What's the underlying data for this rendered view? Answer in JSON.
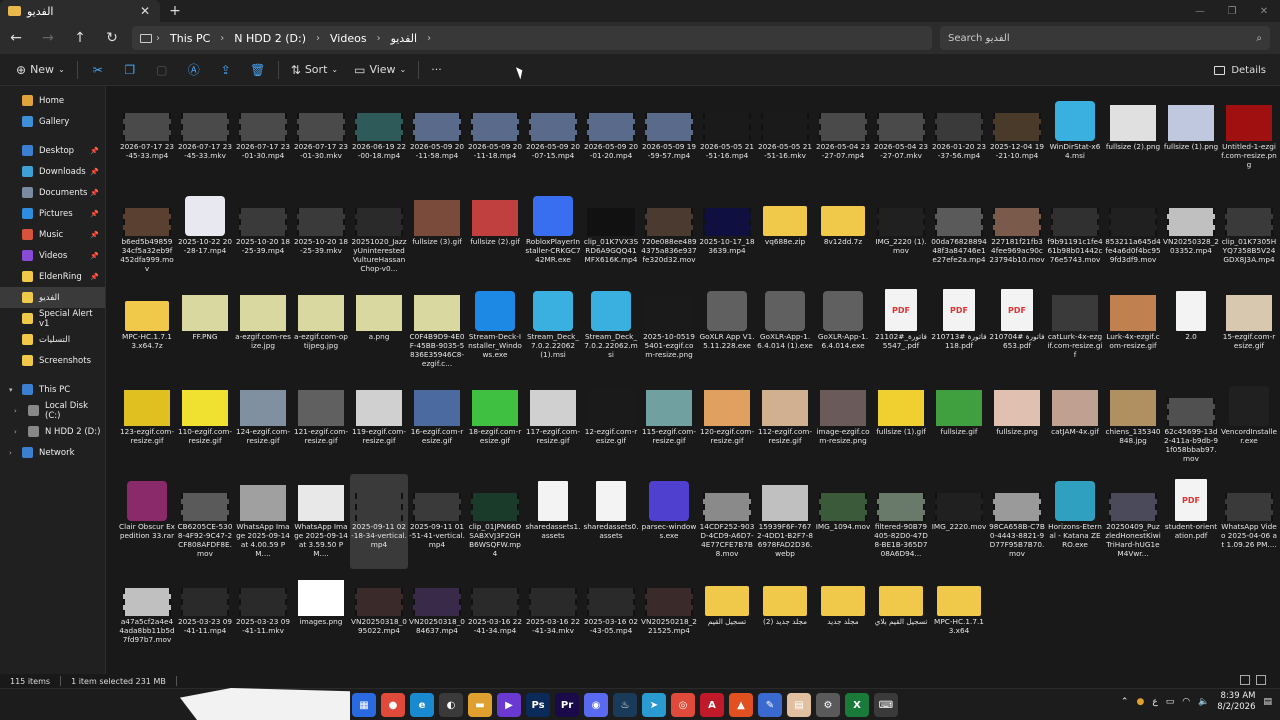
{
  "tab": {
    "title": "الفديو",
    "close": "✕",
    "new_tab": "+"
  },
  "nav": {
    "back": "←",
    "forward": "→",
    "up": "↑",
    "refresh": "↻"
  },
  "address": {
    "crumbs": [
      "This PC",
      "N HDD 2 (D:)",
      "Videos",
      "الفديو"
    ],
    "search_placeholder": "Search الفديو"
  },
  "command_bar": {
    "new_label": "New",
    "sort_label": "Sort",
    "view_label": "View",
    "more_label": "···",
    "details_label": "Details"
  },
  "sidebar": {
    "items": [
      {
        "label": "Home",
        "color": "#e0a23c"
      },
      {
        "label": "Gallery",
        "color": "#3f8fd8"
      },
      {
        "label": "Desktop",
        "color": "#3a7fd0",
        "pinned": true
      },
      {
        "label": "Downloads",
        "color": "#3fa0d8",
        "pinned": true
      },
      {
        "label": "Documents",
        "color": "#7a8aa0",
        "pinned": true
      },
      {
        "label": "Pictures",
        "color": "#2f8de0",
        "pinned": true
      },
      {
        "label": "Music",
        "color": "#d8533c",
        "pinned": true
      },
      {
        "label": "Videos",
        "color": "#8a4ad8",
        "pinned": true
      },
      {
        "label": "EldenRing",
        "color": "#f0c94a",
        "pinned": true
      },
      {
        "label": "الفديو",
        "color": "#f0c94a"
      },
      {
        "label": "Special Alert v1",
        "color": "#f0c94a"
      },
      {
        "label": "التسليات",
        "color": "#f0c94a"
      },
      {
        "label": "Screenshots",
        "color": "#f0c94a"
      },
      {
        "label": "This PC",
        "color": "#3a7fd0",
        "expand": "▾"
      },
      {
        "label": "Local Disk (C:)",
        "color": "#888888",
        "expand": "›"
      },
      {
        "label": "N HDD 2 (D:)",
        "color": "#888888",
        "expand": "›"
      },
      {
        "label": "Network",
        "color": "#3a7fd0",
        "expand": "›"
      }
    ]
  },
  "files": [
    {
      "name": "2026-07-17 23-45-33.mp4",
      "kind": "video",
      "color": "#4a4a4a"
    },
    {
      "name": "2026-07-17 23-45-33.mkv",
      "kind": "video",
      "color": "#4a4a4a"
    },
    {
      "name": "2026-07-17 23-01-30.mp4",
      "kind": "video",
      "color": "#4a4a4a"
    },
    {
      "name": "2026-07-17 23-01-30.mkv",
      "kind": "video",
      "color": "#4a4a4a"
    },
    {
      "name": "2026-06-19 22-00-18.mp4",
      "kind": "video",
      "color": "#2e5a5a"
    },
    {
      "name": "2026-05-09 20-11-58.mp4",
      "kind": "video",
      "color": "#5a6a8a"
    },
    {
      "name": "2026-05-09 20-11-18.mp4",
      "kind": "video",
      "color": "#5a6a8a"
    },
    {
      "name": "2026-05-09 20-07-15.mp4",
      "kind": "video",
      "color": "#5a6a8a"
    },
    {
      "name": "2026-05-09 20-01-20.mp4",
      "kind": "video",
      "color": "#5a6a8a"
    },
    {
      "name": "2026-05-09 19-59-57.mp4",
      "kind": "video",
      "color": "#5a6a8a"
    },
    {
      "name": "2026-05-05 21-51-16.mp4",
      "kind": "video",
      "color": "#1a1a1a"
    },
    {
      "name": "2026-05-05 21-51-16.mkv",
      "kind": "video",
      "color": "#1a1a1a"
    },
    {
      "name": "2026-05-04 23-27-07.mp4",
      "kind": "video",
      "color": "#4a4a4a"
    },
    {
      "name": "2026-05-04 23-27-07.mkv",
      "kind": "video",
      "color": "#4a4a4a"
    },
    {
      "name": "2026-01-20 23-37-56.mp4",
      "kind": "video",
      "color": "#3a3a3a"
    },
    {
      "name": "2025-12-04 19-21-10.mp4",
      "kind": "video",
      "color": "#4a3a2a"
    },
    {
      "name": "WinDirStat-x64.msi",
      "kind": "app",
      "color": "#3ab0e0"
    },
    {
      "name": "fullsize (2).png",
      "kind": "img",
      "color": "#e0e0e0"
    },
    {
      "name": "fullsize (1).png",
      "kind": "img",
      "color": "#c0c8e0"
    },
    {
      "name": "Untitled-1-ezgif.com-resize.png",
      "kind": "img",
      "color": "#a01010"
    },
    {
      "name": "b6ed5b49859 34cf5a32eb9f 452dfa999.mov",
      "kind": "video",
      "color": "#5a4030"
    },
    {
      "name": "2025-10-22 20-28-17.mp4",
      "kind": "app",
      "color": "#e8e8f0"
    },
    {
      "name": "2025-10-20 18-25-39.mp4",
      "kind": "video",
      "color": "#3a3a3a"
    },
    {
      "name": "2025-10-20 18-25-39.mkv",
      "kind": "video",
      "color": "#3a3a3a"
    },
    {
      "name": "20251020_JazzyUninterestedVultureHassanChop-v0...",
      "kind": "video",
      "color": "#2a2a2a"
    },
    {
      "name": "fullsize (3).gif",
      "kind": "img",
      "color": "#7a4a3a"
    },
    {
      "name": "fullsize (2).gif",
      "kind": "img",
      "color": "#c04040"
    },
    {
      "name": "RobloxPlayerInstaller-CRKGC742MR.exe",
      "kind": "app",
      "color": "#3a6ef0"
    },
    {
      "name": "clip_01K7VX3SRD6A9GQQ41MFX616K.mp4",
      "kind": "video",
      "color": "#111111"
    },
    {
      "name": "720e088ee4894375a836e937fe320d32.mov",
      "kind": "video",
      "color": "#4a3a30"
    },
    {
      "name": "2025-10-17_183639.mp4",
      "kind": "video",
      "color": "#101040"
    },
    {
      "name": "vq688e.zip",
      "kind": "folder",
      "color": "#f0c94a"
    },
    {
      "name": "8v12dd.7z",
      "kind": "folder",
      "color": "#f0c94a"
    },
    {
      "name": "IMG_2220 (1).mov",
      "kind": "video",
      "color": "#202020"
    },
    {
      "name": "00da7682889448f3a84746e1e27efe2a.mp4",
      "kind": "video",
      "color": "#5a5a5a"
    },
    {
      "name": "227181f21fb34fee969ac90c23794b10.mov",
      "kind": "video",
      "color": "#7a5a4a"
    },
    {
      "name": "f9b91191c1fe461b98b01442c76e5743.mov",
      "kind": "video",
      "color": "#303030"
    },
    {
      "name": "853211a645d4fe4a6d0f4bc959fd3df9.mov",
      "kind": "video",
      "color": "#202020"
    },
    {
      "name": "VN20250328_203352.mp4",
      "kind": "video",
      "color": "#c0c0c0"
    },
    {
      "name": "clip_01K7305HYQ7358B5V24GDX8J3A.mp4",
      "kind": "video",
      "color": "#3a3a3a"
    },
    {
      "name": "MPC-HC.1.7.13.x64.7z",
      "kind": "folder",
      "color": "#f0c94a"
    },
    {
      "name": "FF.PNG",
      "kind": "img",
      "color": "#d8d8a0"
    },
    {
      "name": "a-ezgif.com-resize.jpg",
      "kind": "img",
      "color": "#d8d8a0"
    },
    {
      "name": "a-ezgif.com-optijpeg.jpg",
      "kind": "img",
      "color": "#d8d8a0"
    },
    {
      "name": "a.png",
      "kind": "img",
      "color": "#d8d8a0"
    },
    {
      "name": "C0F4B9D9-4E0F-45BB-9035-5836E35946C8-ezgif.c...",
      "kind": "img",
      "color": "#d8d8a0"
    },
    {
      "name": "Stream-Deck-Installer_Windows.exe",
      "kind": "app",
      "color": "#1e88e5"
    },
    {
      "name": "Stream_Deck_7.0.2.22062 (1).msi",
      "kind": "app",
      "color": "#3ab0e0"
    },
    {
      "name": "Stream_Deck_7.0.2.22062.msi",
      "kind": "app",
      "color": "#3ab0e0"
    },
    {
      "name": "2025-10-0519 5401-ezgif.com-resize.png",
      "kind": "img",
      "color": "#1a1a1a"
    },
    {
      "name": "GoXLR App V1.5.11.228.exe",
      "kind": "app",
      "color": "#606060"
    },
    {
      "name": "GoXLR-App-1.6.4.014 (1).exe",
      "kind": "app",
      "color": "#606060"
    },
    {
      "name": "GoXLR-App-1.6.4.014.exe",
      "kind": "app",
      "color": "#606060"
    },
    {
      "name": "فاتورة_#211025547_.pdf",
      "kind": "pdf",
      "color": "#f3f3f3"
    },
    {
      "name": "فاتورة #210713118.pdf",
      "kind": "pdf",
      "color": "#f3f3f3"
    },
    {
      "name": "فاتورة #210704653.pdf",
      "kind": "pdf",
      "color": "#f3f3f3"
    },
    {
      "name": "catLurk-4x-ezgif.com-resize.gif",
      "kind": "img",
      "color": "#3a3a3a"
    },
    {
      "name": "Lurk-4x-ezgif.com-resize.gif",
      "kind": "img",
      "color": "#c08050"
    },
    {
      "name": "2.0",
      "kind": "file",
      "color": "#f3f3f3"
    },
    {
      "name": "15-ezgif.com-resize.gif",
      "kind": "img",
      "color": "#d8c8b0"
    },
    {
      "name": "123-ezgif.com-resize.gif",
      "kind": "img",
      "color": "#e0c020"
    },
    {
      "name": "110-ezgif.com-resize.gif",
      "kind": "img",
      "color": "#f0e030"
    },
    {
      "name": "124-ezgif.com-resize.gif",
      "kind": "img",
      "color": "#8090a0"
    },
    {
      "name": "121-ezgif.com-resize.gif",
      "kind": "img",
      "color": "#606060"
    },
    {
      "name": "119-ezgif.com-resize.gif",
      "kind": "img",
      "color": "#d0d0d0"
    },
    {
      "name": "16-ezgif.com-resize.gif",
      "kind": "img",
      "color": "#4a6aa0"
    },
    {
      "name": "18-ezgif.com-resize.gif",
      "kind": "img",
      "color": "#40c040"
    },
    {
      "name": "117-ezgif.com-resize.gif",
      "kind": "img",
      "color": "#d0d0d0"
    },
    {
      "name": "12-ezgif.com-resize.gif",
      "kind": "img",
      "color": "#1a1a1a"
    },
    {
      "name": "115-ezgif.com-resize.gif",
      "kind": "img",
      "color": "#70a0a0"
    },
    {
      "name": "120-ezgif.com-resize.gif",
      "kind": "img",
      "color": "#e0a060"
    },
    {
      "name": "112-ezgif.com-resize.gif",
      "kind": "img",
      "color": "#d0b090"
    },
    {
      "name": "image-ezgif.com-resize.png",
      "kind": "img",
      "color": "#6a5a5a"
    },
    {
      "name": "fullsize (1).gif",
      "kind": "img",
      "color": "#f0d030"
    },
    {
      "name": "fullsize.gif",
      "kind": "img",
      "color": "#40a040"
    },
    {
      "name": "fullsize.png",
      "kind": "img",
      "color": "#e0c0b0"
    },
    {
      "name": "catJAM-4x.gif",
      "kind": "img",
      "color": "#c0a090"
    },
    {
      "name": "chiens_135340848.jpg",
      "kind": "img",
      "color": "#b09060"
    },
    {
      "name": "62c45699-13d2-411a-b9db-91f058bbab97.mov",
      "kind": "video",
      "color": "#505050"
    },
    {
      "name": "VencordInstaller.exe",
      "kind": "app",
      "color": "#202020"
    },
    {
      "name": "Clair Obscur Expedition 33.rar",
      "kind": "app",
      "color": "#8a2a6a"
    },
    {
      "name": "CB6205CE-5308-4F92-9C47-2CF808AFDF8E.mov",
      "kind": "video",
      "color": "#5a5a5a"
    },
    {
      "name": "WhatsApp Image 2025-09-14 at 4.00.59 PM....",
      "kind": "img",
      "color": "#a0a0a0"
    },
    {
      "name": "WhatsApp Image 2025-09-14 at 3.59.50 PM....",
      "kind": "img",
      "color": "#e8e8e8"
    },
    {
      "name": "2025-09-11 02-18-34-vertical.mp4",
      "kind": "video",
      "color": "#3a3a3a"
    },
    {
      "name": "2025-09-11 01-51-41-vertical.mp4",
      "kind": "video",
      "color": "#3a3a3a"
    },
    {
      "name": "clip_01JPN66DSABXVJ3F2GHB6WSQFW.mp4",
      "kind": "video",
      "color": "#1a3a2a"
    },
    {
      "name": "sharedassets1.assets",
      "kind": "file",
      "color": "#f3f3f3"
    },
    {
      "name": "sharedassets0.assets",
      "kind": "file",
      "color": "#f3f3f3"
    },
    {
      "name": "parsec-windows.exe",
      "kind": "app",
      "color": "#5040d0"
    },
    {
      "name": "14CDF252-903D-4CD9-A6D7-4E77CFE7B7B8.mov",
      "kind": "video",
      "color": "#8a8a8a"
    },
    {
      "name": "15939F6F-7672-4DD1-B2F7-86978FAD2D36.webp",
      "kind": "img",
      "color": "#c0c0c0"
    },
    {
      "name": "IMG_1094.mov",
      "kind": "video",
      "color": "#3a5a3a"
    },
    {
      "name": "filtered-90B79405-82D0-47D8-BE1B-365D708A6D94...",
      "kind": "video",
      "color": "#6a7a6a"
    },
    {
      "name": "IMG_2220.mov",
      "kind": "video",
      "color": "#202020"
    },
    {
      "name": "98CA658B-C7B0-4443-8821-9D77F95B7B70.mov",
      "kind": "video",
      "color": "#9a9a9a"
    },
    {
      "name": "Horizons-Eternal - Katana ZERO.exe",
      "kind": "app",
      "color": "#30a0c0"
    },
    {
      "name": "20250409_PuzzledHonestKiwiTriHard-hUG1eM4Vwr...",
      "kind": "video",
      "color": "#4a4a5a"
    },
    {
      "name": "student-orientation.pdf",
      "kind": "pdf",
      "color": "#f3f3f3"
    },
    {
      "name": "WhatsApp Video 2025-04-06 at 1.09.26 PM....",
      "kind": "video",
      "color": "#3a3a3a"
    },
    {
      "name": "a47a5cf2a4e44ada8bb11b5d7fd97b7.mov",
      "kind": "video",
      "color": "#c0c0c0"
    },
    {
      "name": "2025-03-23 09-41-11.mp4",
      "kind": "video",
      "color": "#2a2a2a"
    },
    {
      "name": "2025-03-23 09-41-11.mkv",
      "kind": "video",
      "color": "#2a2a2a"
    },
    {
      "name": "images.png",
      "kind": "img",
      "color": "#ffffff"
    },
    {
      "name": "VN20250318_095022.mp4",
      "kind": "video",
      "color": "#3a2a2a"
    },
    {
      "name": "VN20250318_084637.mp4",
      "kind": "video",
      "color": "#3a2a4a"
    },
    {
      "name": "2025-03-16 22-41-34.mp4",
      "kind": "video",
      "color": "#2a2a2a"
    },
    {
      "name": "2025-03-16 22-41-34.mkv",
      "kind": "video",
      "color": "#2a2a2a"
    },
    {
      "name": "2025-03-16 02-43-05.mp4",
      "kind": "video",
      "color": "#2a2a2a"
    },
    {
      "name": "VN20250218_221525.mp4",
      "kind": "video",
      "color": "#3a2a2a"
    },
    {
      "name": "تسجيل القيم",
      "kind": "folder",
      "color": "#f0c94a"
    },
    {
      "name": "مجلد جديد (2)",
      "kind": "folder",
      "color": "#f0c94a"
    },
    {
      "name": "مجلد جديد",
      "kind": "folder",
      "color": "#f0c94a"
    },
    {
      "name": "تسجيل القيم بلاي",
      "kind": "folder",
      "color": "#f0c94a"
    },
    {
      "name": "MPC-HC.1.7.13.x64",
      "kind": "folder",
      "color": "#f0c94a"
    }
  ],
  "selected_index": 84,
  "status": {
    "count": "115 items",
    "selection": "1 item selected  231 MB"
  },
  "taskbar": {
    "apps": [
      {
        "label": "▦",
        "color": "#2a6ae0"
      },
      {
        "label": "●",
        "color": "#e04a3a"
      },
      {
        "label": "e",
        "color": "#1a8ad0"
      },
      {
        "label": "◐",
        "color": "#3a3a3a"
      },
      {
        "label": "▬",
        "color": "#e0a030"
      },
      {
        "label": "▶",
        "color": "#6a3ad0"
      },
      {
        "label": "Ps",
        "color": "#0a2a5a"
      },
      {
        "label": "Pr",
        "color": "#1a0a4a"
      },
      {
        "label": "◉",
        "color": "#5a6af0"
      },
      {
        "label": "♨",
        "color": "#1a3a5a"
      },
      {
        "label": "➤",
        "color": "#2a9ad0"
      },
      {
        "label": "◎",
        "color": "#e04a3a"
      },
      {
        "label": "A",
        "color": "#c01a2a"
      },
      {
        "label": "▲",
        "color": "#e05020"
      },
      {
        "label": "✎",
        "color": "#3a6ad0"
      },
      {
        "label": "▤",
        "color": "#e0c0a0"
      },
      {
        "label": "⚙",
        "color": "#5a5a5a"
      },
      {
        "label": "X",
        "color": "#1a7a3a"
      },
      {
        "label": "⌨",
        "color": "#3a3a3a"
      }
    ],
    "lang": "ع",
    "time": "8:39 AM",
    "date": "8/2/2026"
  }
}
